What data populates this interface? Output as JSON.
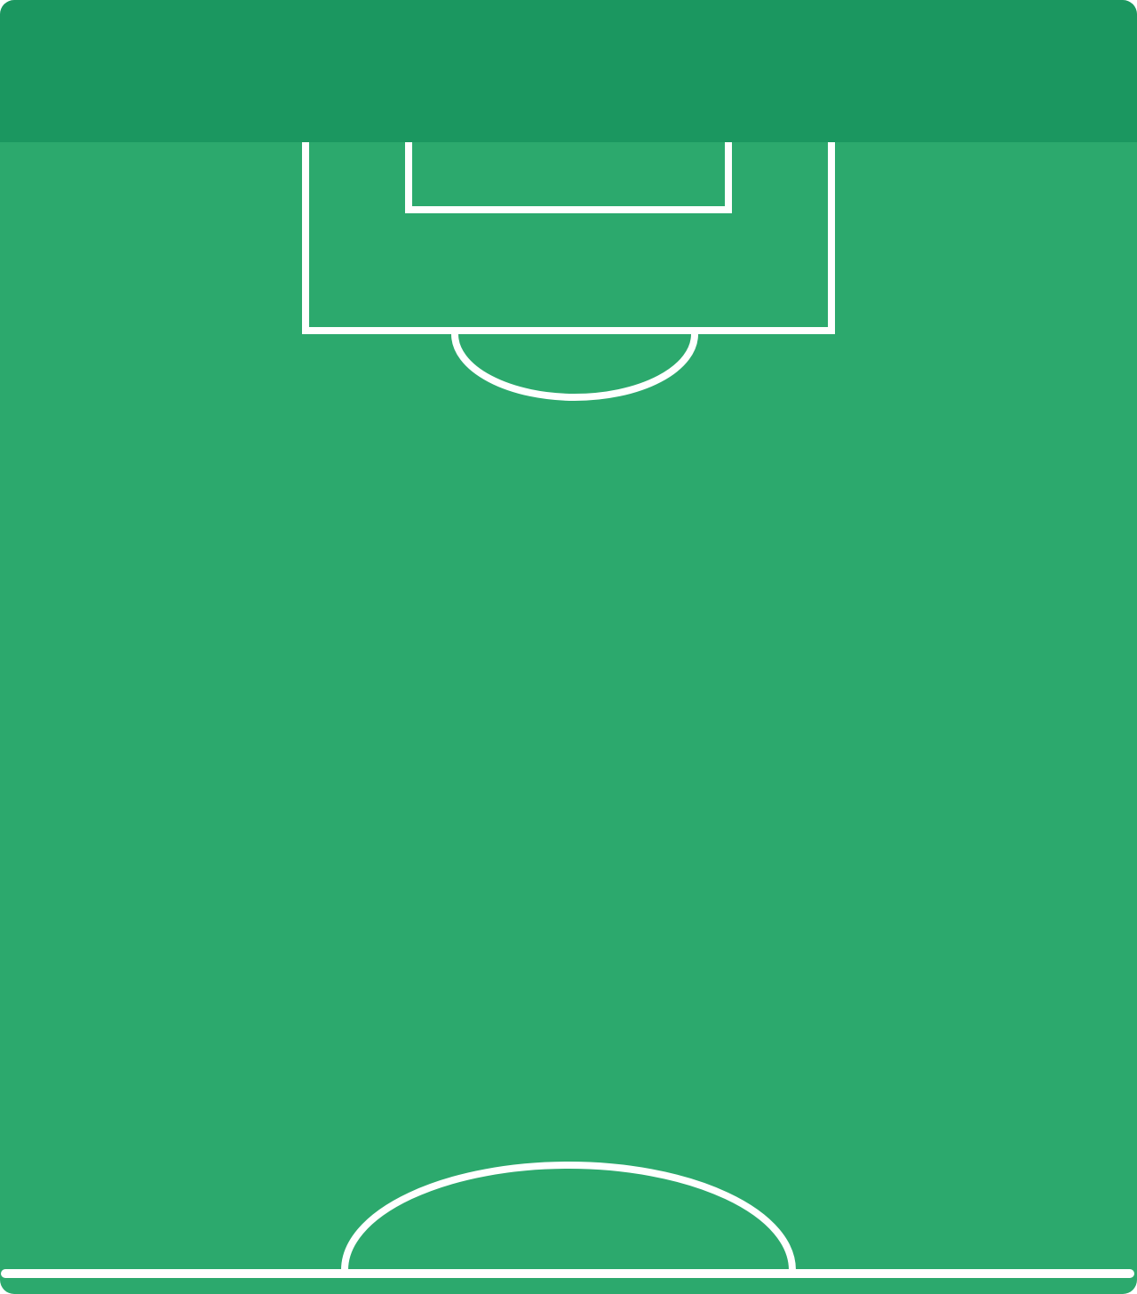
{
  "pitch": {
    "colors": {
      "header_band": "#1b9760",
      "field": "#2ca96d",
      "lines": "#ffffff"
    },
    "view": "half-pitch-top-goal"
  }
}
